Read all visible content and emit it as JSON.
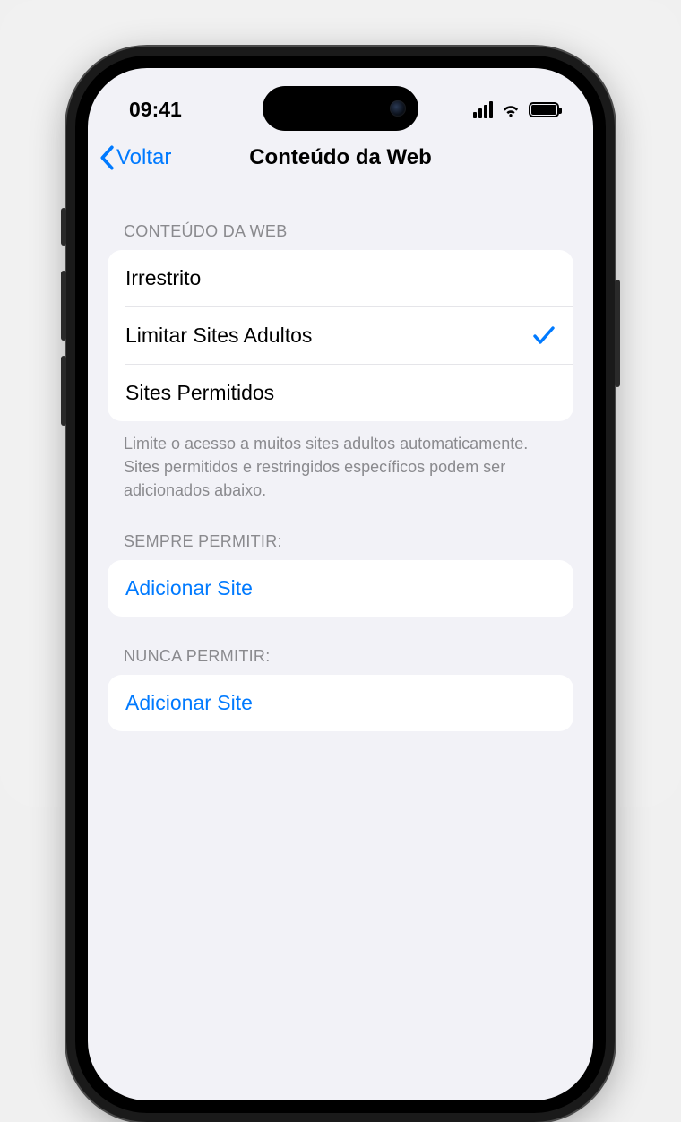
{
  "status": {
    "time": "09:41"
  },
  "nav": {
    "back_label": "Voltar",
    "title": "Conteúdo da Web"
  },
  "section_web": {
    "header": "CONTEÚDO DA WEB",
    "options": {
      "unrestricted": "Irrestrito",
      "limit_adult": "Limitar Sites Adultos",
      "allowed_only": "Sites Permitidos"
    },
    "selected": "limit_adult",
    "footer": "Limite o acesso a muitos sites adultos automaticamente. Sites permitidos e restringidos específicos podem ser adicionados abaixo."
  },
  "section_allow": {
    "header": "SEMPRE PERMITIR:",
    "add_label": "Adicionar Site"
  },
  "section_never": {
    "header": "NUNCA PERMITIR:",
    "add_label": "Adicionar Site"
  },
  "colors": {
    "accent": "#007aff"
  }
}
